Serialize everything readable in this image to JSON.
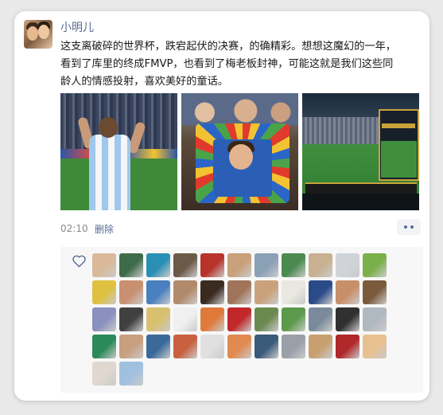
{
  "post": {
    "author": "小明儿",
    "text_line1": "这支离破碎的世界杯，跌宕起伏的决赛，的确精彩。想想这魔幻的一年，",
    "text_line2": "看到了库里的终成FMVP，也看到了梅老板封神，可能这就是我们这些同",
    "text_line3": "龄人的情感投射，喜欢美好的童话。",
    "time": "02:10",
    "delete_label": "删除",
    "photos": [
      "photo-messi-celebration",
      "photo-fans-banner",
      "photo-stadium-broadcast"
    ]
  },
  "likes": {
    "icon": "heart-icon",
    "accent_color": "#576b95",
    "avatars": [
      "#d9b99a",
      "#3e6b4a",
      "#2a8fb5",
      "#6b5a48",
      "#b8332a",
      "#c8a07a",
      "#8aa0b5",
      "#4a8a50",
      "#c8b090",
      "#d0d4d8",
      "#7ab04a",
      "#e0c040",
      "#c89070",
      "#4a7fc0",
      "#b08a6a",
      "#3a2a20",
      "#a0745a",
      "#c9a27b",
      "#e8e8e0",
      "#2a4a8a",
      "#c8906a",
      "#7a5a3a",
      "#8a90c0",
      "#404040",
      "#d8c070",
      "#f0f0f0",
      "#e07a3a",
      "#c0282a",
      "#6a8a50",
      "#5a9a4a",
      "#7a8a9a",
      "#303030",
      "#b0b8c0",
      "#2a8a5a",
      "#c8a080",
      "#3a6a9a",
      "#c86040",
      "#e0e0e0",
      "#e08a50",
      "#3a5a7a",
      "#9aa0a8",
      "#c8a070",
      "#b0282a",
      "#e8c090",
      "#e0d8d0",
      "#a0c0e0"
    ]
  }
}
